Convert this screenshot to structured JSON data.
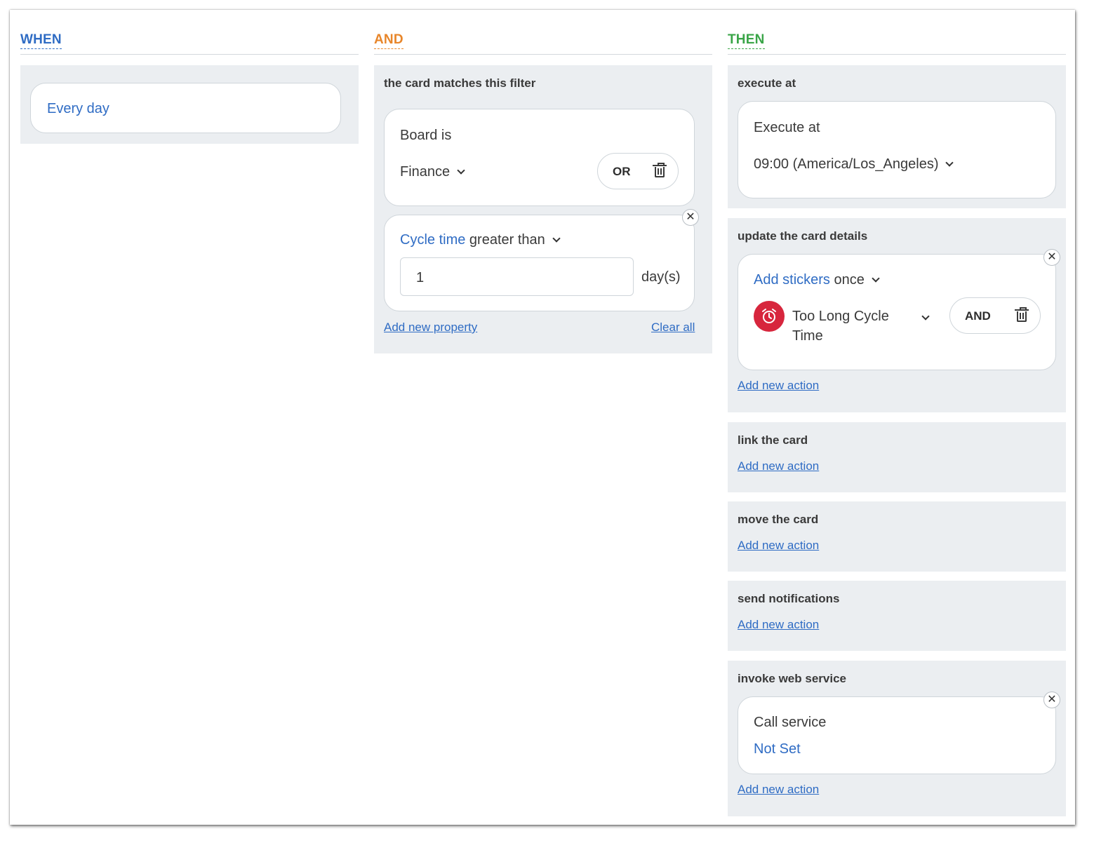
{
  "when": {
    "header": "WHEN",
    "trigger": "Every day"
  },
  "and": {
    "header": "AND",
    "section_title": "the card matches this filter",
    "board_filter": {
      "label": "Board is",
      "value": "Finance",
      "operator": "OR"
    },
    "cycle_filter": {
      "property": "Cycle time",
      "comparator": "greater than",
      "value": "1",
      "unit": "day(s)"
    },
    "add_property_link": "Add new property",
    "clear_all_link": "Clear all"
  },
  "then": {
    "header": "THEN",
    "execute_at": {
      "section_title": "execute at",
      "label": "Execute at",
      "value": "09:00 (America/Los_Angeles)"
    },
    "update_card": {
      "section_title": "update the card details",
      "action": "Add stickers",
      "frequency": "once",
      "sticker_name": "Too Long Cycle Time",
      "operator": "AND",
      "sticker_color": "#d7263d",
      "sticker_icon": "alarm-clock-icon",
      "add_action_link": "Add new action"
    },
    "link_card": {
      "section_title": "link the card",
      "add_action_link": "Add new action"
    },
    "move_card": {
      "section_title": "move the card",
      "add_action_link": "Add new action"
    },
    "send_notifications": {
      "section_title": "send notifications",
      "add_action_link": "Add new action"
    },
    "invoke_web_service": {
      "section_title": "invoke web service",
      "label": "Call service",
      "value": "Not Set",
      "add_action_link": "Add new action"
    }
  },
  "colors": {
    "when_accent": "#2f6cc4",
    "and_accent": "#e8862a",
    "then_accent": "#3aa548",
    "link": "#2f6cc4",
    "section_bg": "#ebeef1"
  }
}
